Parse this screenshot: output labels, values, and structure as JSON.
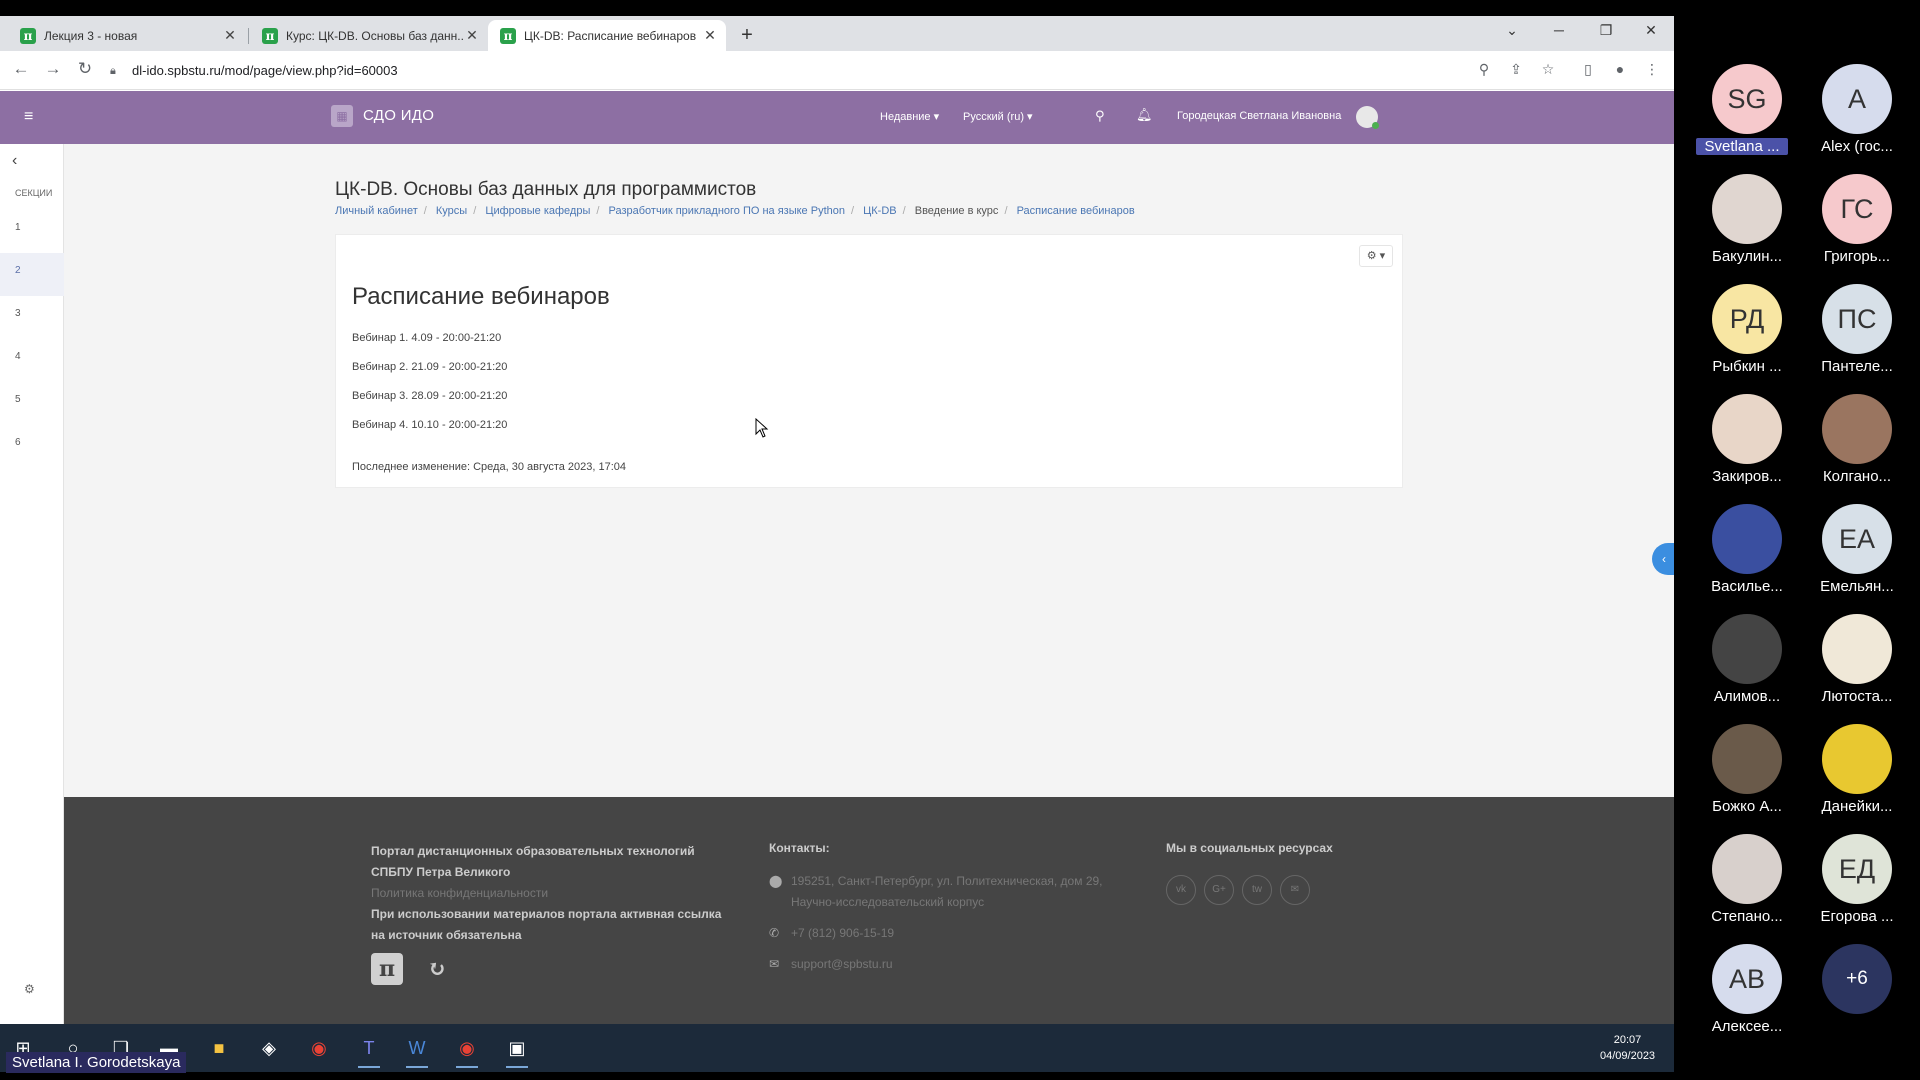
{
  "browser": {
    "tabs": [
      {
        "title": "Лекция 3 - новая",
        "active": false
      },
      {
        "title": "Курс: ЦК-DB. Основы баз данн...",
        "active": false
      },
      {
        "title": "ЦК-DB: Расписание вебинаров",
        "active": true
      }
    ],
    "url": "dl-ido.spbstu.ru/mod/page/view.php?id=60003"
  },
  "navbar": {
    "site_name": "СДО ИДО",
    "recent": "Недавние ▾",
    "language": "Русский (ru) ▾",
    "user_name": "Городецкая Светлана Ивановна"
  },
  "drawer": {
    "title": "СЕКЦИИ",
    "items": [
      "1",
      "2",
      "3",
      "4",
      "5",
      "6"
    ],
    "active_index": 1
  },
  "course": {
    "title": "ЦК-DB. Основы баз данных для программистов",
    "breadcrumb": [
      "Личный кабинет",
      "Курсы",
      "Цифровые кафедры",
      "Разработчик прикладного ПО на языке Python",
      "ЦК-DB",
      "Введение в курс",
      "Расписание вебинаров"
    ]
  },
  "content": {
    "heading": "Расписание вебинаров",
    "webinars": [
      "Вебинар 1. 4.09 - 20:00-21:20",
      "Вебинар 2. 21.09 - 20:00-21:20",
      "Вебинар 3. 28.09 - 20:00-21:20",
      "Вебинар 4. 10.10 - 20:00-21:20"
    ],
    "last_modified": "Последнее изменение: Среда, 30 августа 2023, 17:04"
  },
  "footer": {
    "col1_line1": "Портал дистанционных образовательных технологий СПБПУ Петра Великого",
    "col1_privacy": "Политика конфиденциальности",
    "col1_note": "При использовании материалов портала активная ссылка на источник обязательна",
    "contacts_heading": "Контакты:",
    "address": "195251, Санкт-Петербург, ул. Политехническая, дом 29, Научно-исследовательский корпус",
    "phone": "+7 (812) 906-15-19",
    "email": "support@spbstu.ru",
    "social_heading": "Мы в социальных ресурсах",
    "social": [
      "vk",
      "G+",
      "tw",
      "✉"
    ]
  },
  "taskbar": {
    "time": "20:07",
    "date": "04/09/2023"
  },
  "presenter": "Svetlana I. Gorodetskaya",
  "participants": [
    {
      "initials": "SG",
      "name": "Svetlana ...",
      "bg": "#f6c9cc",
      "highlight": true
    },
    {
      "initials": "A",
      "name": "Alex (гос...",
      "bg": "#d6dced"
    },
    {
      "initials": "",
      "name": "Бакулин...",
      "bg": "#e0d6d0"
    },
    {
      "initials": "ГС",
      "name": "Григорь...",
      "bg": "#f6c9cc"
    },
    {
      "initials": "РД",
      "name": "Рыбкин ...",
      "bg": "#f8e6a3"
    },
    {
      "initials": "ПС",
      "name": "Пантеле...",
      "bg": "#d7e0e8"
    },
    {
      "initials": "",
      "name": "Закиров...",
      "bg": "#e8d6c8"
    },
    {
      "initials": "",
      "name": "Колгано...",
      "bg": "#9a7560"
    },
    {
      "initials": "",
      "name": "Васильe...",
      "bg": "#3a4fa0"
    },
    {
      "initials": "ЕА",
      "name": "Емельян...",
      "bg": "#d7e0e8"
    },
    {
      "initials": "",
      "name": "Алимов...",
      "bg": "#444"
    },
    {
      "initials": "",
      "name": "Лютоста...",
      "bg": "#f0e8d8"
    },
    {
      "initials": "",
      "name": "Божко А...",
      "bg": "#6a5a4a"
    },
    {
      "initials": "",
      "name": "Данейки...",
      "bg": "#e8c830"
    },
    {
      "initials": "",
      "name": "Степано...",
      "bg": "#d8d0cc"
    },
    {
      "initials": "ЕД",
      "name": "Егорова ...",
      "bg": "#dfe4d8"
    },
    {
      "initials": "АВ",
      "name": "Алексее...",
      "bg": "#d6dced"
    },
    {
      "initials": "+6",
      "name": "",
      "bg": "#2c3560"
    }
  ]
}
